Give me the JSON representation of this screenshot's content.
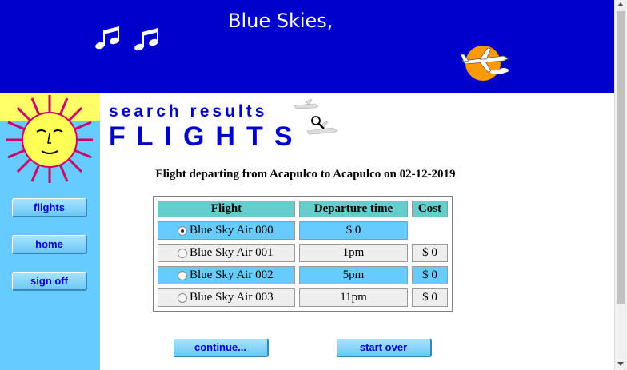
{
  "header": {
    "title": "Blue Skies,"
  },
  "sidebar": {
    "items": [
      {
        "label": "flights"
      },
      {
        "label": "home"
      },
      {
        "label": "sign off"
      }
    ]
  },
  "main": {
    "search_heading": "search results",
    "flights_heading": "FLIGHTS",
    "caption": "Flight departing from Acapulco to Acapulco on 02-12-2019",
    "table": {
      "headers": [
        "Flight",
        "Departure time",
        "Cost"
      ],
      "rows": [
        {
          "flight": "Blue Sky Air 000",
          "time": "$ 0",
          "cost": "",
          "selected": true
        },
        {
          "flight": "Blue Sky Air 001",
          "time": "1pm",
          "cost": "$ 0",
          "selected": false
        },
        {
          "flight": "Blue Sky Air 002",
          "time": "5pm",
          "cost": "$ 0",
          "selected": false
        },
        {
          "flight": "Blue Sky Air 003",
          "time": "11pm",
          "cost": "$ 0",
          "selected": false
        }
      ]
    },
    "buttons": {
      "continue": "continue...",
      "start_over": "start over"
    }
  },
  "colors": {
    "header_bg": "#0000cc",
    "sidebar_bg": "#66ccff",
    "accent_text": "#0000cc",
    "table_header_bg": "#66cccc",
    "row_highlight": "#66ccff",
    "row_plain": "#eeeeee"
  },
  "icons": [
    "music-notes-icon",
    "airplane-sun-logo",
    "sun-face-icon",
    "magnifier-icon",
    "clouds-icon"
  ]
}
